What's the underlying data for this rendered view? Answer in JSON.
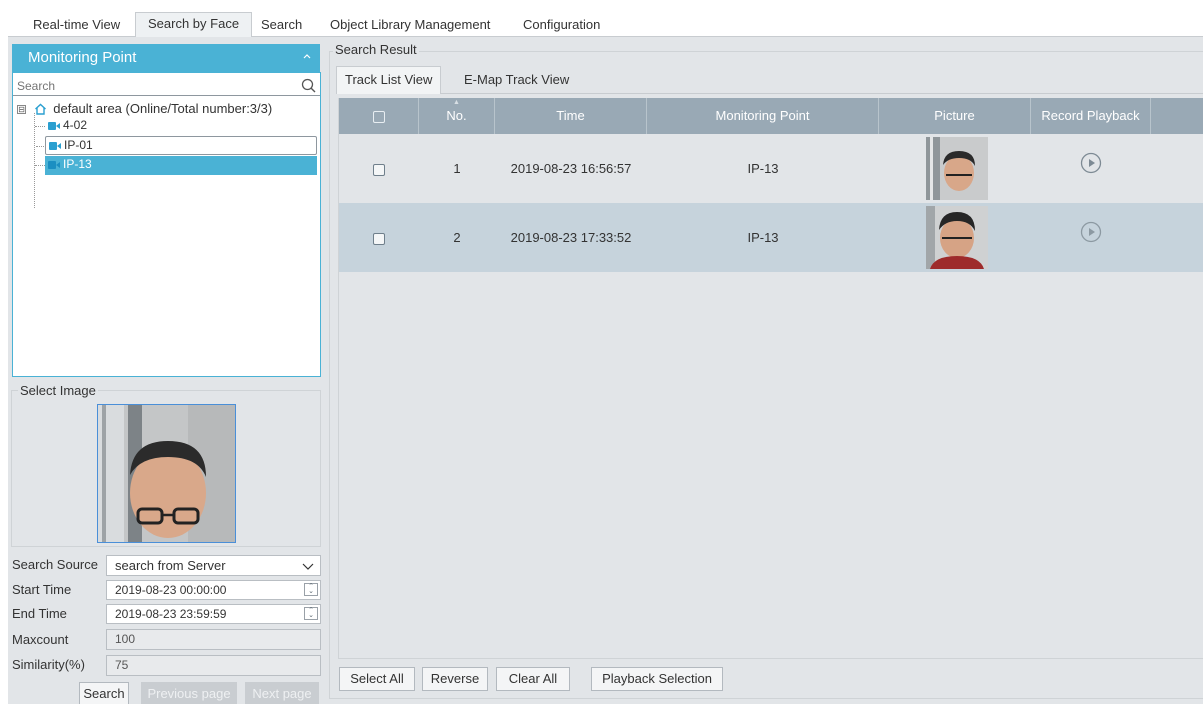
{
  "top_tabs": [
    {
      "label": "Real-time View"
    },
    {
      "label": "Search by Face",
      "active": true
    },
    {
      "label": "Search"
    },
    {
      "label": "Object Library Management"
    },
    {
      "label": "Configuration"
    }
  ],
  "monitoring_point": {
    "title": "Monitoring Point",
    "search_placeholder": "Search",
    "root": {
      "label": "default area (Online/Total number:3/3)",
      "expander": "⊟"
    },
    "items": [
      {
        "label": "4-02"
      },
      {
        "label": "IP-01"
      },
      {
        "label": "IP-13",
        "selected": true
      }
    ]
  },
  "select_image": {
    "label": "Select Image"
  },
  "form": {
    "search_source_label": "Search Source",
    "search_source_value": "search from Server",
    "start_time_label": "Start Time",
    "start_time_value": "2019-08-23 00:00:00",
    "end_time_label": "End Time",
    "end_time_value": "2019-08-23 23:59:59",
    "maxcount_label": "Maxcount",
    "maxcount_value": "100",
    "similarity_label": "Similarity(%)",
    "similarity_value": "75"
  },
  "left_buttons": {
    "search": "Search",
    "previous_page": "Previous page",
    "next_page": "Next page"
  },
  "search_result": {
    "label": "Search Result",
    "tabs": [
      {
        "label": "Track List View",
        "active": true
      },
      {
        "label": "E-Map Track View"
      }
    ],
    "columns": [
      "No.",
      "Time",
      "Monitoring Point",
      "Picture",
      "Record Playback"
    ],
    "rows": [
      {
        "no": "1",
        "time": "2019-08-23 16:56:57",
        "point": "IP-13"
      },
      {
        "no": "2",
        "time": "2019-08-23 17:33:52",
        "point": "IP-13"
      }
    ]
  },
  "bottom_buttons": {
    "select_all": "Select All",
    "reverse": "Reverse",
    "clear_all": "Clear All",
    "playback_selection": "Playback Selection"
  },
  "colors": {
    "accent": "#4ab2d5",
    "table_header": "#99a9b5",
    "row_highlight": "#c6d3dc",
    "panel_bg": "#e2e5e8"
  }
}
